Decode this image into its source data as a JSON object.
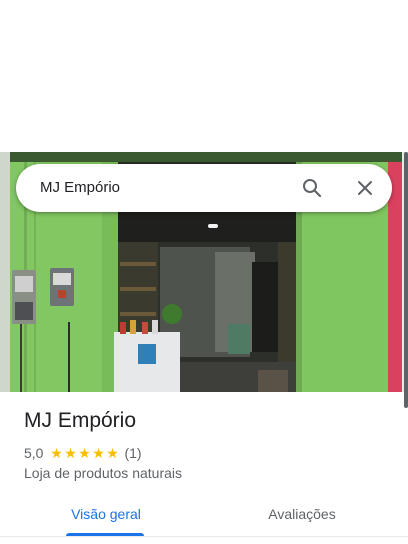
{
  "search": {
    "query": "MJ Empório",
    "search_icon": "search-icon",
    "close_icon": "close-icon"
  },
  "place": {
    "name": "MJ Empório",
    "rating": "5,0",
    "stars": 5,
    "review_count": "(1)",
    "category": "Loja de produtos naturais",
    "photo": "storefront-photo"
  },
  "tabs": [
    {
      "label": "Visão geral",
      "selected": true
    },
    {
      "label": "Avaliações",
      "selected": false
    }
  ],
  "colors": {
    "accent": "#1a73e8",
    "star": "#fbbc04",
    "text_primary": "#202124",
    "text_secondary": "#5f6368",
    "storefront_wall": "#7dc35f"
  }
}
